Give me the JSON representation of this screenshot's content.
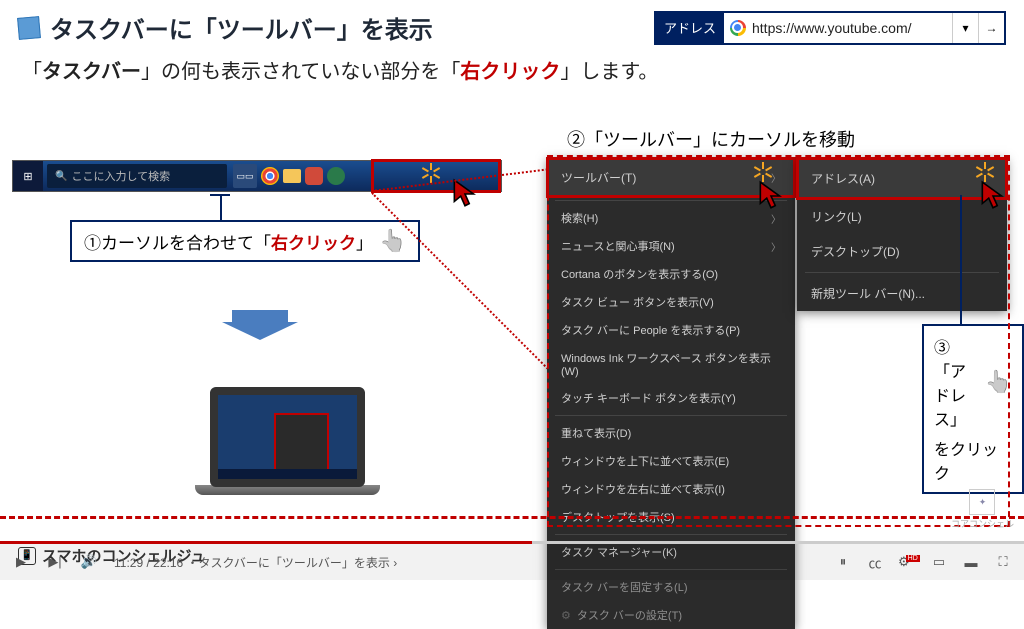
{
  "header": {
    "title": "タスクバーに「ツールバー」を表示",
    "address_label": "アドレス",
    "address_url": "https://www.youtube.com/",
    "dropdown": "▾",
    "go": "→"
  },
  "subtitle": {
    "pre": "「",
    "bold1": "タスクバー",
    "mid": "」の何も表示されていない部分を「",
    "red": "右クリック",
    "post": "」します。"
  },
  "taskbar": {
    "search_placeholder": "ここに入力して検索"
  },
  "steps": {
    "s1_pre": "①カーソルを合わせて「",
    "s1_red": "右クリック",
    "s1_post": "」",
    "s2": "②「ツールバー」にカーソルを移動",
    "s3_l1": "③「アドレス」",
    "s3_l2": "をクリック"
  },
  "context_menu": {
    "items": [
      "ツールバー(T)",
      "検索(H)",
      "ニュースと関心事項(N)",
      "Cortana のボタンを表示する(O)",
      "タスク ビュー ボタンを表示(V)",
      "タスク バーに People を表示する(P)",
      "Windows Ink ワークスペース ボタンを表示(W)",
      "タッチ キーボード ボタンを表示(Y)",
      "重ねて表示(D)",
      "ウィンドウを上下に並べて表示(E)",
      "ウィンドウを左右に並べて表示(I)",
      "デスクトップを表示(S)",
      "タスク マネージャー(K)",
      "タスク バーを固定する(L)",
      "タスク バーの設定(T)"
    ]
  },
  "submenu": {
    "items": [
      "アドレス(A)",
      "リンク(L)",
      "デスクトップ(D)",
      "新規ツール バー(N)..."
    ]
  },
  "video": {
    "time": "11:29 / 22:16",
    "chapter": "・タスクバーに「ツールバー」を表示",
    "chevron": "›"
  },
  "watermark": "コアコンシェル",
  "channel": "スマホのコンシェルジュ"
}
